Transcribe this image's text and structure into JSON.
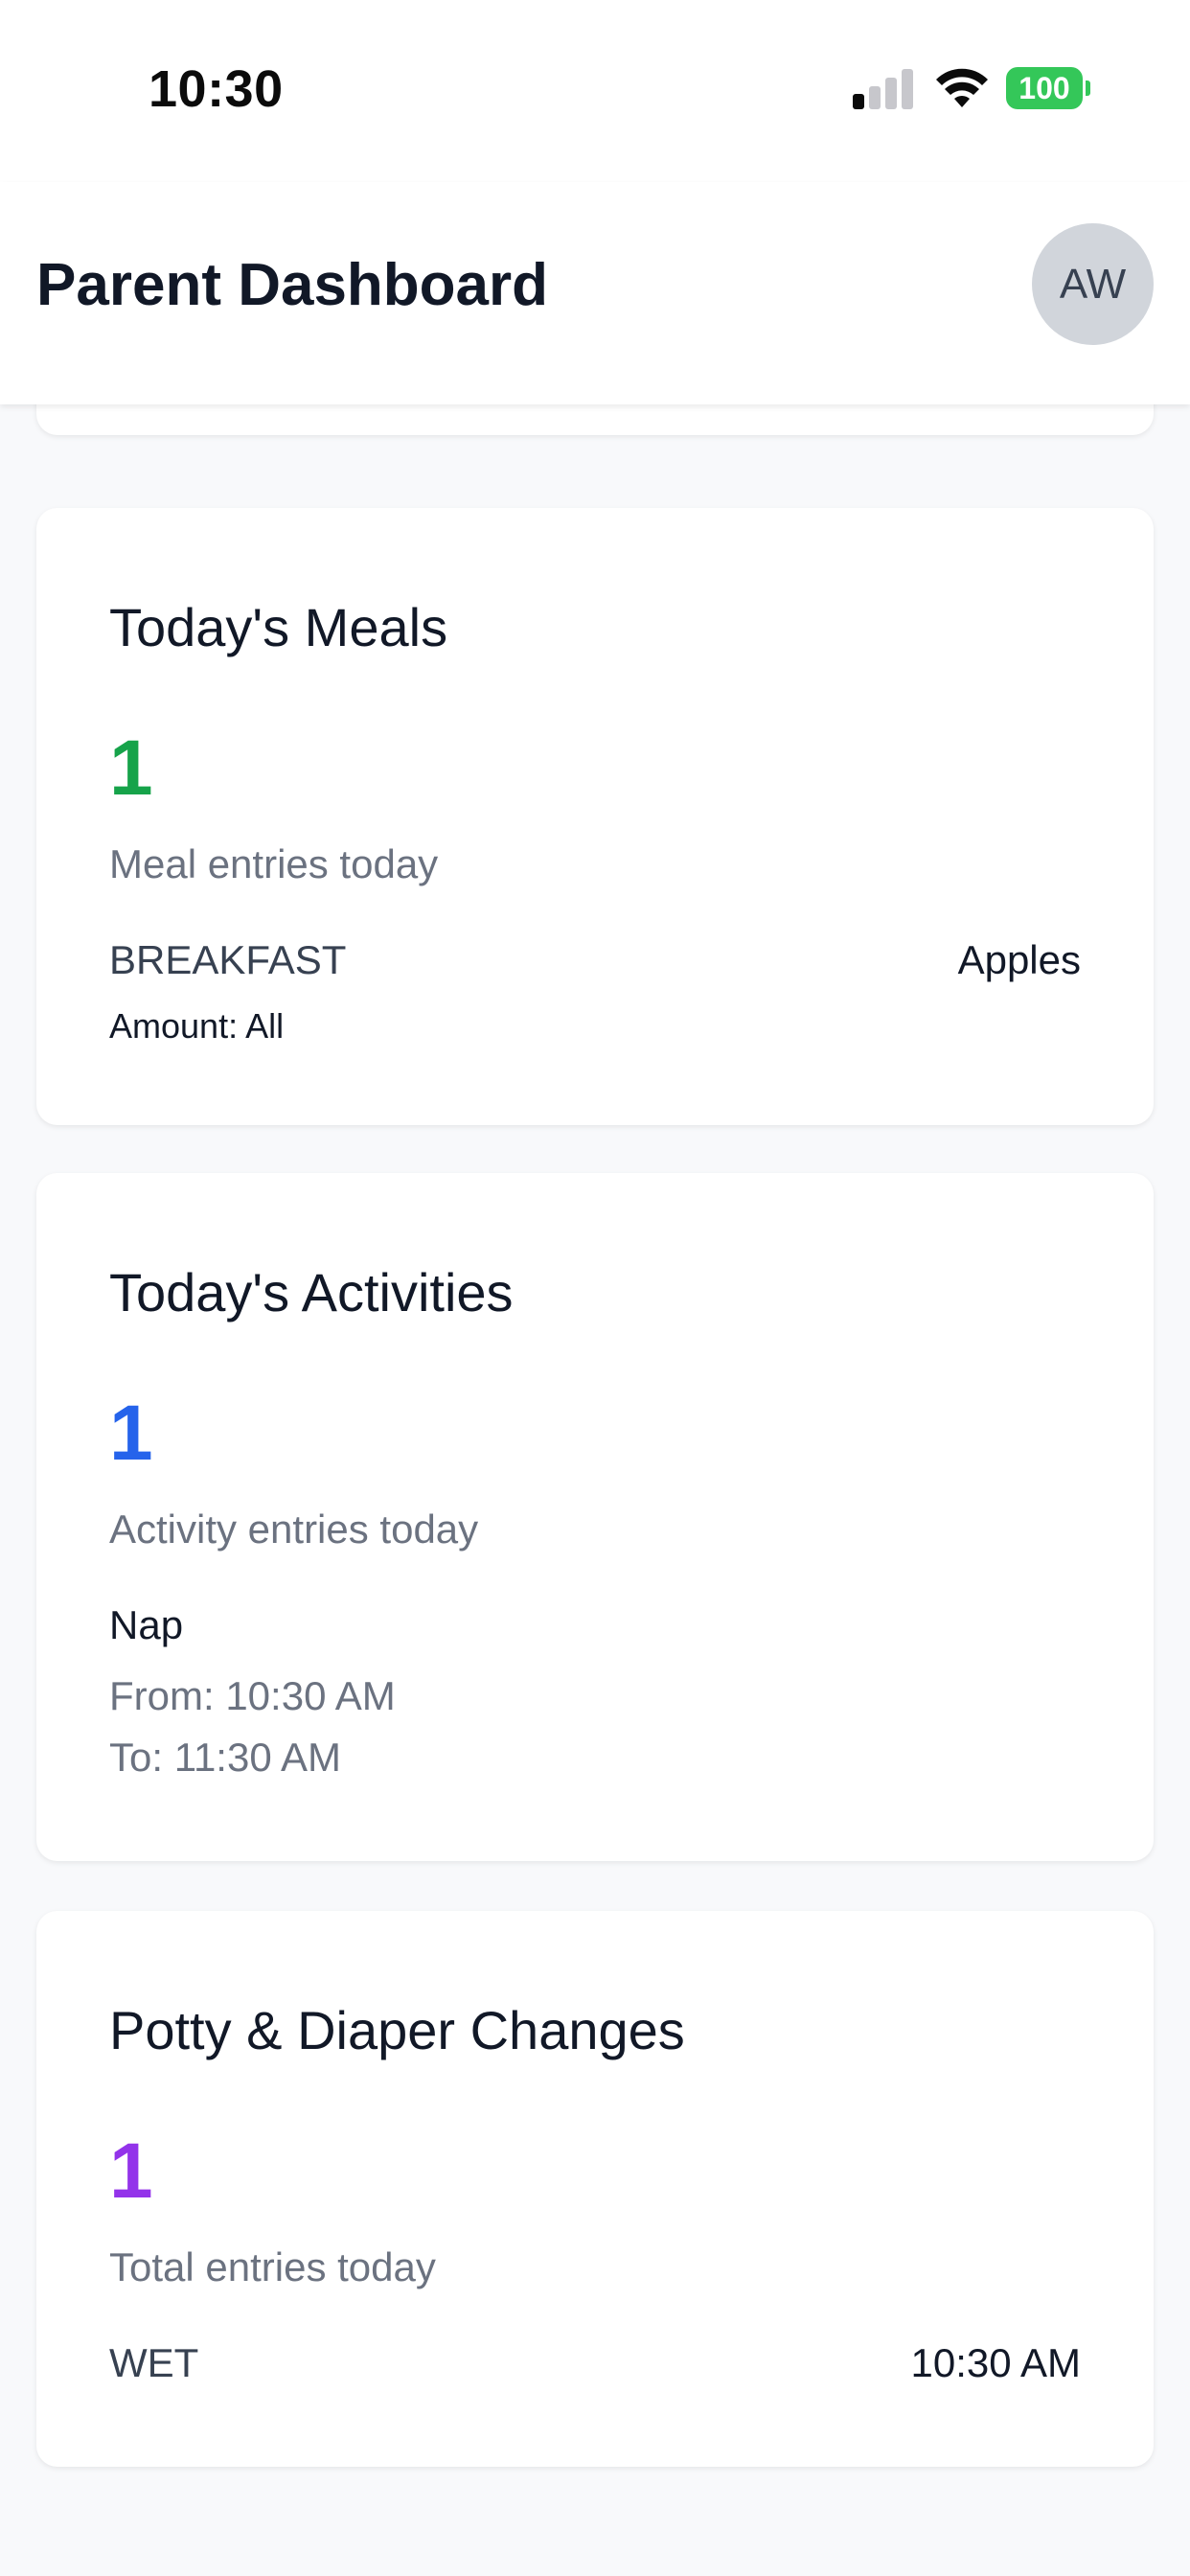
{
  "status_bar": {
    "time": "10:30",
    "battery": "100",
    "colors": {
      "battery": "#34c759"
    }
  },
  "header": {
    "title": "Parent Dashboard",
    "avatar_initials": "AW"
  },
  "meals": {
    "title": "Today's Meals",
    "count": "1",
    "subtitle": "Meal entries today",
    "entry": {
      "meal_type": "BREAKFAST",
      "food": "Apples",
      "amount": "Amount: All"
    },
    "accent": "#16a34a"
  },
  "activities": {
    "title": "Today's Activities",
    "count": "1",
    "subtitle": "Activity entries today",
    "entry": {
      "name": "Nap",
      "from": "From: 10:30 AM",
      "to": "To: 11:30 AM"
    },
    "accent": "#2563eb"
  },
  "potty": {
    "title": "Potty & Diaper Changes",
    "count": "1",
    "subtitle": "Total entries today",
    "entry": {
      "type": "WET",
      "time": "10:30 AM"
    },
    "accent": "#9333ea"
  }
}
